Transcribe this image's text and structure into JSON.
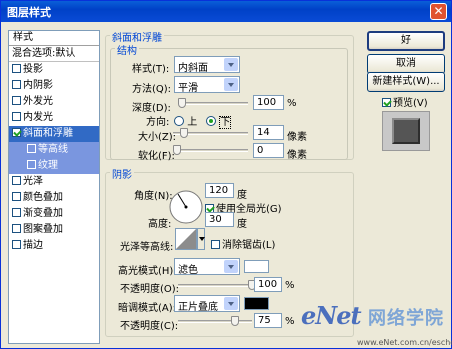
{
  "window": {
    "title": "图层样式"
  },
  "styles_panel": {
    "header": "样式",
    "items": [
      {
        "label": "混合选项:默认",
        "checkbox": false,
        "checked": false,
        "selected": false,
        "sub": false
      },
      {
        "label": "投影",
        "checkbox": true,
        "checked": false,
        "selected": false,
        "sub": false
      },
      {
        "label": "内阴影",
        "checkbox": true,
        "checked": false,
        "selected": false,
        "sub": false
      },
      {
        "label": "外发光",
        "checkbox": true,
        "checked": false,
        "selected": false,
        "sub": false
      },
      {
        "label": "内发光",
        "checkbox": true,
        "checked": false,
        "selected": false,
        "sub": false
      },
      {
        "label": "斜面和浮雕",
        "checkbox": true,
        "checked": true,
        "selected": true,
        "sub": false
      },
      {
        "label": "等高线",
        "checkbox": true,
        "checked": false,
        "selected": false,
        "sub": true
      },
      {
        "label": "纹理",
        "checkbox": true,
        "checked": false,
        "selected": false,
        "sub": true
      },
      {
        "label": "光泽",
        "checkbox": true,
        "checked": false,
        "selected": false,
        "sub": false
      },
      {
        "label": "颜色叠加",
        "checkbox": true,
        "checked": false,
        "selected": false,
        "sub": false
      },
      {
        "label": "渐变叠加",
        "checkbox": true,
        "checked": false,
        "selected": false,
        "sub": false
      },
      {
        "label": "图案叠加",
        "checkbox": true,
        "checked": false,
        "selected": false,
        "sub": false
      },
      {
        "label": "描边",
        "checkbox": true,
        "checked": false,
        "selected": false,
        "sub": false
      }
    ]
  },
  "bevel": {
    "section_title": "斜面和浮雕",
    "structure_title": "结构",
    "style_label": "样式(T):",
    "style_value": "内斜面",
    "technique_label": "方法(Q):",
    "technique_value": "平滑",
    "depth_label": "深度(D):",
    "depth_value": "100",
    "depth_unit": "%",
    "depth_level": 0.0,
    "direction_label": "方向:",
    "direction_up": "上",
    "direction_down": "下",
    "direction_selected": "down",
    "size_label": "大小(Z):",
    "size_value": "14",
    "size_unit": "像素",
    "size_level": 0.1,
    "soften_label": "软化(F):",
    "soften_value": "0",
    "soften_unit": "像素",
    "soften_level": 0.0
  },
  "shading": {
    "section_title": "阴影",
    "angle_label": "角度(N):",
    "angle_value": "120",
    "angle_unit": "度",
    "global_light_label": "使用全局光(G)",
    "global_light_checked": true,
    "altitude_label": "高度:",
    "altitude_value": "30",
    "altitude_unit": "度",
    "gloss_contour_label": "光泽等高线:",
    "antialias_label": "消除锯齿(L)",
    "antialias_checked": false,
    "highlight_mode_label": "高光模式(H):",
    "highlight_mode_value": "滤色",
    "highlight_color": "#ffffff",
    "highlight_opacity_label": "不透明度(O):",
    "highlight_opacity_value": "100",
    "highlight_opacity_unit": "%",
    "highlight_opacity_level": 1.0,
    "shadow_mode_label": "暗调模式(A):",
    "shadow_mode_value": "正片叠底",
    "shadow_color": "#000000",
    "shadow_opacity_label": "不透明度(C):",
    "shadow_opacity_value": "75",
    "shadow_opacity_unit": "%",
    "shadow_opacity_level": 0.75
  },
  "buttons": {
    "ok": "好",
    "cancel": "取消",
    "new_style": "新建样式(W)...",
    "preview_label": "预览(V)",
    "preview_checked": true
  },
  "watermark": {
    "brand": "eNet",
    "cn": "网络学院",
    "url": "www.eNet.com.cn/eschool"
  },
  "colors": {
    "accent": "#316ac5",
    "title_bar": "#0041c7",
    "dialog_bg": "#ece9d8"
  }
}
